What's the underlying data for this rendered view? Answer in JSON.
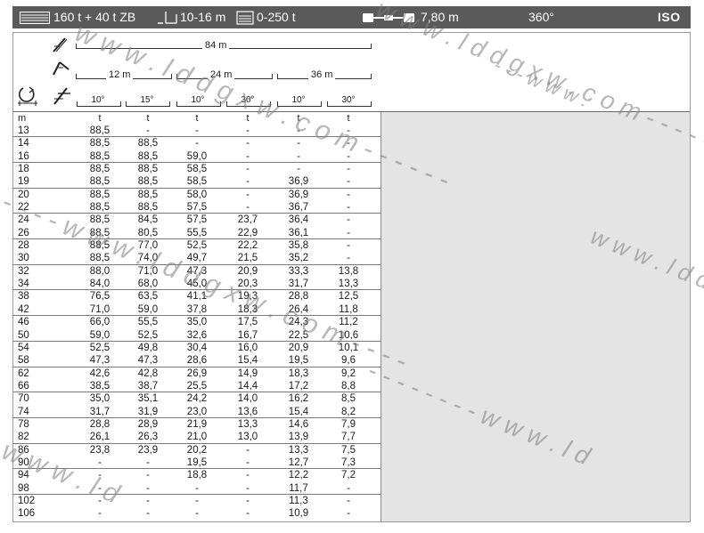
{
  "header": {
    "counterweight": "160 t + 40 t ZB",
    "superlift_radius": "10-16 m",
    "superlift_weight": "0-250 t",
    "track_width": "7,80 m",
    "slew": "360°",
    "norm": "ISO"
  },
  "config": {
    "main_boom": "84 m",
    "jibs": [
      {
        "length": "12 m",
        "angles": [
          "10°",
          "15°"
        ]
      },
      {
        "length": "24 m",
        "angles": [
          "10°",
          "30°"
        ]
      },
      {
        "length": "36 m",
        "angles": [
          "10°",
          "30°"
        ]
      }
    ]
  },
  "units": [
    "m",
    "t",
    "t",
    "t",
    "t",
    "t",
    "t"
  ],
  "rows": [
    [
      "13",
      "88,5",
      "-",
      "-",
      "-",
      "-",
      "-"
    ],
    [
      "14",
      "88,5",
      "88,5",
      "-",
      "-",
      "-",
      "-"
    ],
    [
      "16",
      "88,5",
      "88,5",
      "59,0",
      "-",
      "-",
      "-"
    ],
    [
      "18",
      "88,5",
      "88,5",
      "58,5",
      "-",
      "-",
      "-"
    ],
    [
      "19",
      "88,5",
      "88,5",
      "58,5",
      "-",
      "36,9",
      "-"
    ],
    [
      "20",
      "88,5",
      "88,5",
      "58,0",
      "-",
      "36,9",
      "-"
    ],
    [
      "22",
      "88,5",
      "88,5",
      "57,5",
      "-",
      "36,7",
      "-"
    ],
    [
      "24",
      "88,5",
      "84,5",
      "57,5",
      "23,7",
      "36,4",
      "-"
    ],
    [
      "26",
      "88,5",
      "80,5",
      "55,5",
      "22,9",
      "36,1",
      "-"
    ],
    [
      "28",
      "88,5",
      "77,0",
      "52,5",
      "22,2",
      "35,8",
      "-"
    ],
    [
      "30",
      "88,5",
      "74,0",
      "49,7",
      "21,5",
      "35,2",
      "-"
    ],
    [
      "32",
      "88,0",
      "71,0",
      "47,3",
      "20,9",
      "33,3",
      "13,8"
    ],
    [
      "34",
      "84,0",
      "68,0",
      "45,0",
      "20,3",
      "31,7",
      "13,3"
    ],
    [
      "38",
      "76,5",
      "63,5",
      "41,1",
      "19,3",
      "28,8",
      "12,5"
    ],
    [
      "42",
      "71,0",
      "59,0",
      "37,8",
      "18,3",
      "26,4",
      "11,8"
    ],
    [
      "46",
      "66,0",
      "55,5",
      "35,0",
      "17,5",
      "24,3",
      "11,2"
    ],
    [
      "50",
      "59,0",
      "52,5",
      "32,6",
      "16,7",
      "22,5",
      "10,6"
    ],
    [
      "54",
      "52,5",
      "49,8",
      "30,4",
      "16,0",
      "20,9",
      "10,1"
    ],
    [
      "58",
      "47,3",
      "47,3",
      "28,6",
      "15,4",
      "19,5",
      "9,6"
    ],
    [
      "62",
      "42,6",
      "42,8",
      "26,9",
      "14,9",
      "18,3",
      "9,2"
    ],
    [
      "66",
      "38,5",
      "38,7",
      "25,5",
      "14,4",
      "17,2",
      "8,8"
    ],
    [
      "70",
      "35,0",
      "35,1",
      "24,2",
      "14,0",
      "16,2",
      "8,5"
    ],
    [
      "74",
      "31,7",
      "31,9",
      "23,0",
      "13,6",
      "15,4",
      "8,2"
    ],
    [
      "78",
      "28,8",
      "28,9",
      "21,9",
      "13,3",
      "14,6",
      "7,9"
    ],
    [
      "82",
      "26,1",
      "26,3",
      "21,0",
      "13,0",
      "13,9",
      "7,7"
    ],
    [
      "86",
      "23,8",
      "23,9",
      "20,2",
      "-",
      "13,3",
      "7,5"
    ],
    [
      "90",
      "-",
      "-",
      "19,5",
      "-",
      "12,7",
      "7,3"
    ],
    [
      "94",
      "-",
      "-",
      "18,8",
      "-",
      "12,2",
      "7,2"
    ],
    [
      "98",
      "-",
      "-",
      "-",
      "-",
      "11,7",
      "-"
    ],
    [
      "102",
      "-",
      "-",
      "-",
      "-",
      "11,3",
      "-"
    ],
    [
      "106",
      "-",
      "-",
      "-",
      "-",
      "10,9",
      "-"
    ]
  ],
  "watermark": {
    "text_a": "w w w . l d d g x w . c o m - - - - - -",
    "text_b": "- - - - w w w . l d d g x w . c o m - - - -",
    "text_c": "- - - - - - - - w w w . l d",
    "text_d": "w w w . l d",
    "text_e": "w w w . l d d g x w . c o m - - -",
    "text_f": "- - - w w w .",
    "color": "#7e7e7e"
  }
}
